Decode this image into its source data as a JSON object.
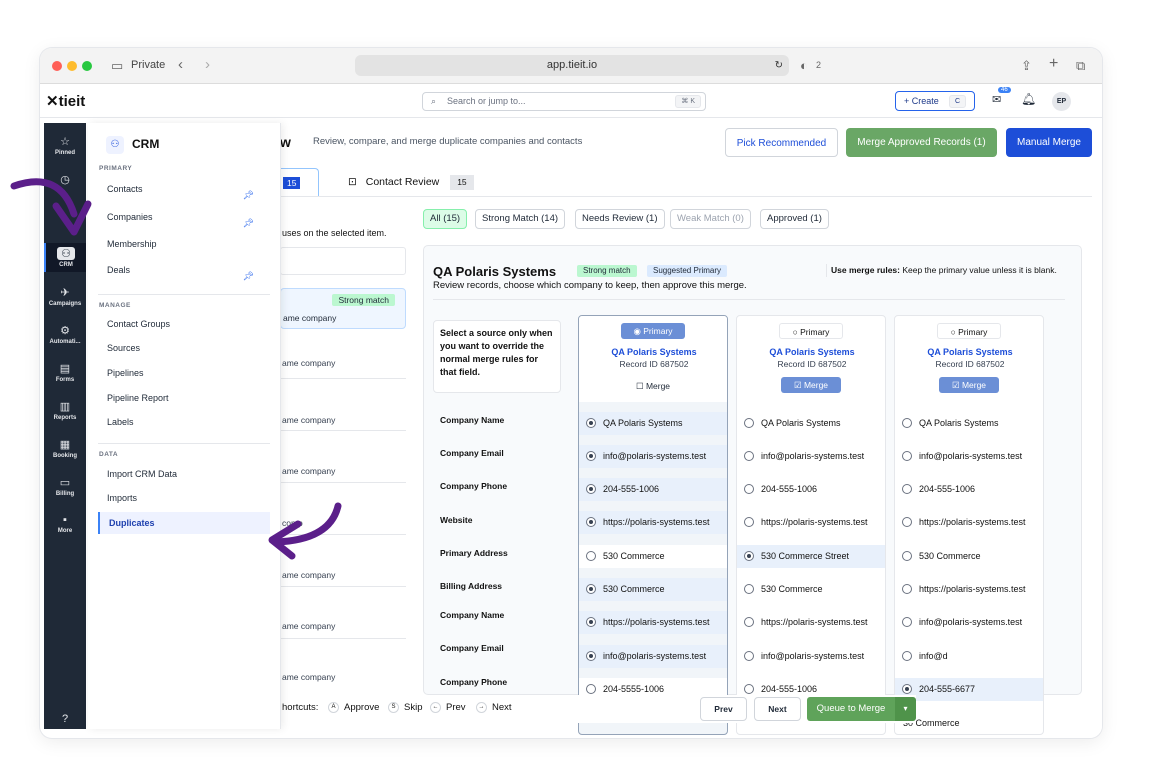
{
  "browser": {
    "private_label": "Private",
    "url": "app.tieit.io",
    "shield_count": "2"
  },
  "app": {
    "logo": "tieit",
    "search_placeholder": "Search or jump to...",
    "search_shortcut": "⌘ K",
    "create_label": "Create",
    "create_kbd": "C",
    "mail_badge": "46",
    "avatar": "EP"
  },
  "rail": [
    {
      "icon": "☆",
      "label": "Pinned"
    },
    {
      "icon": "◷",
      "label": "Recents"
    },
    {
      "icon": "⚇",
      "label": "CRM"
    },
    {
      "icon": "✈",
      "label": "Campaigns"
    },
    {
      "icon": "⚙",
      "label": "Automati..."
    },
    {
      "icon": "▤",
      "label": "Forms"
    },
    {
      "icon": "▥",
      "label": "Reports"
    },
    {
      "icon": "▦",
      "label": "Booking"
    },
    {
      "icon": "▭",
      "label": "Billing"
    },
    {
      "icon": "▪",
      "label": "More"
    }
  ],
  "flyout": {
    "title": "CRM",
    "primary_header": "PRIMARY",
    "manage_header": "MANAGE",
    "data_header": "DATA",
    "primary": [
      "Contacts",
      "Companies",
      "Membership",
      "Deals"
    ],
    "manage": [
      "Contact Groups",
      "Sources",
      "Pipelines",
      "Pipeline Report",
      "Labels"
    ],
    "data": [
      "Import CRM Data",
      "Imports",
      "Duplicates"
    ]
  },
  "page": {
    "title_fragment": "w",
    "subtitle": "Review, compare, and merge duplicate companies and contacts",
    "pick_recommended": "Pick Recommended",
    "merge_approved": "Merge Approved Records (1)",
    "manual_merge": "Manual Merge",
    "tab1_count": "15",
    "tab2_label": "Contact Review",
    "tab2_count": "15",
    "left_hint": "uses on the selected item.",
    "left_badge": "Strong match",
    "left_rows": [
      "ame company",
      "ame company",
      "ame company",
      "ame company",
      "comp",
      "ame company",
      "ame company",
      "ame company"
    ],
    "left_row_suffix": "r"
  },
  "filters": [
    "All (15)",
    "Strong Match (14)",
    "Needs Review (1)",
    "Weak Match (0)",
    "Approved (1)"
  ],
  "card": {
    "title": "QA Polaris Systems",
    "badge_strong": "Strong match",
    "badge_suggested": "Suggested Primary",
    "desc": "Review records, choose which company to keep, then approve this merge.",
    "rules_label": "Use merge rules:",
    "rules_text": " Keep the primary value unless it is blank.",
    "help": "Select a source only when you want to override the normal merge rules for that field.",
    "row_labels": [
      "Company Name",
      "Company Email",
      "Company Phone",
      "Website",
      "Primary Address",
      "Billing Address",
      "Company Name",
      "Company Email",
      "Company Phone"
    ],
    "columns": [
      {
        "primary": "Primary",
        "name": "QA Polaris Systems",
        "record": "Record ID 687502",
        "merge": "Merge",
        "values": [
          "QA Polaris Systems",
          "info@polaris-systems.test",
          "204-555-1006",
          "https://polaris-systems.test",
          "530 Commerce",
          "530 Commerce",
          "https://polaris-systems.test",
          "info@polaris-systems.test",
          "204-5555-1006"
        ]
      },
      {
        "primary": "Primary",
        "name": "QA Polaris Systems",
        "record": "Record ID 687502",
        "merge": "Merge",
        "values": [
          "QA Polaris Systems",
          "info@polaris-systems.test",
          "204-555-1006",
          "https://polaris-systems.test",
          "530 Commerce Street",
          "530 Commerce",
          "https://polaris-systems.test",
          "info@polaris-systems.test",
          "204-555-1006"
        ]
      },
      {
        "primary": "Primary",
        "name": "QA Polaris Systems",
        "record": "Record ID 687502",
        "merge": "Merge",
        "values": [
          "QA Polaris Systems",
          "info@polaris-systems.test",
          "204-555-1006",
          "https://polaris-systems.test",
          "530 Commerce",
          "https://polaris-systems.test",
          "info@polaris-systems.test",
          "info@d",
          "204-555-6677",
          "30 Commerce"
        ]
      }
    ]
  },
  "bottom": {
    "shortcuts": "hortcuts:",
    "approve_key": "A",
    "approve": "Approve",
    "skip_key": "S",
    "skip": "Skip",
    "prev_key": "←",
    "prev": "Prev",
    "next_key": "→",
    "next": "Next",
    "prev_btn": "Prev",
    "next_btn": "Next",
    "queue_btn": "Queue to Merge"
  },
  "colors": {
    "accent": "#1d4ed8",
    "green": "#5fa35a",
    "rail": "#1f2937",
    "arrow": "#5b1f8a"
  }
}
